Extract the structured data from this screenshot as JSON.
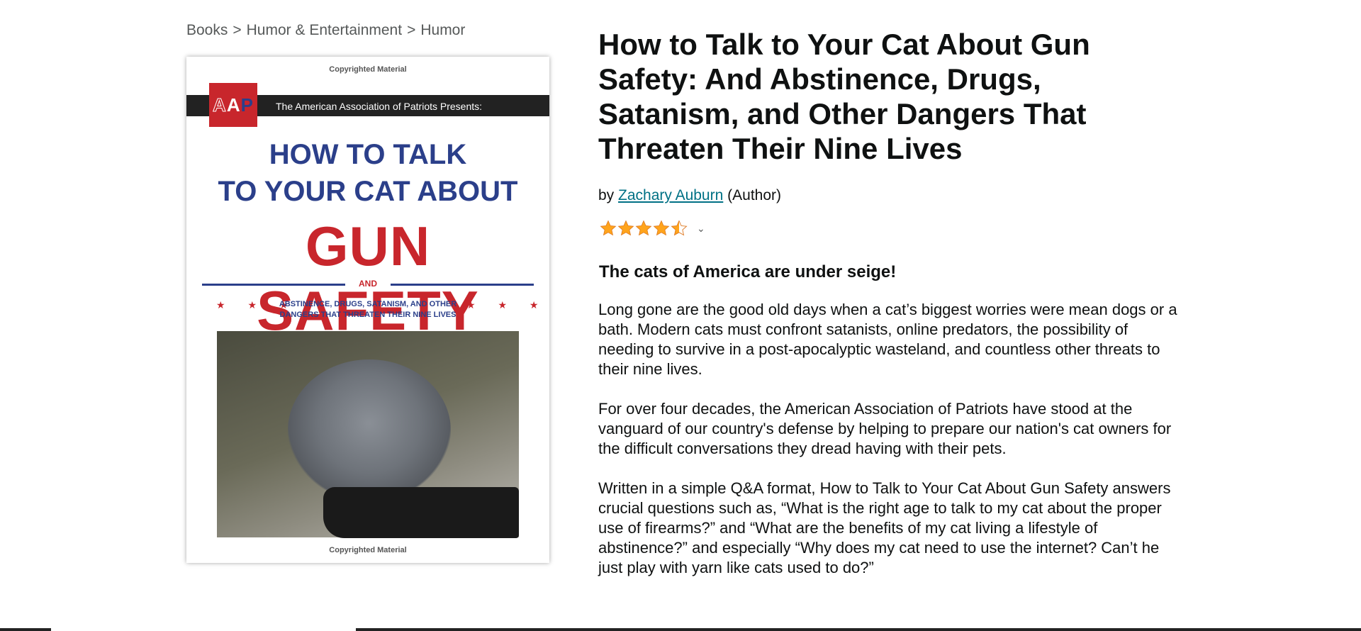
{
  "breadcrumb": {
    "items": [
      "Books",
      "Humor & Entertainment",
      "Humor"
    ],
    "separator": ">"
  },
  "cover": {
    "copyright_top": "Copyrighted Material",
    "copyright_bottom": "Copyrighted Material",
    "logo_text": [
      "A",
      "A",
      "P"
    ],
    "band_text": "The American Association of Patriots Presents:",
    "title_line1": "HOW TO TALK",
    "title_line2": "TO YOUR CAT ABOUT",
    "title_big": "GUN SAFETY",
    "and_word": "AND",
    "subtitle_line1": "ABSTINENCE, DRUGS, SATANISM, AND OTHER",
    "subtitle_line2": "DANGERS THAT THREATEN THEIR NINE LIVES",
    "stars_left": "★ ★ ★",
    "stars_right": "★ ★ ★"
  },
  "product": {
    "title": "How to Talk to Your Cat About Gun Safety: And Abstinence, Drugs, Satanism, and Other Dangers That Threaten Their Nine Lives",
    "by_prefix": "by",
    "author": "Zachary Auburn",
    "author_role": "(Author)",
    "rating_stars": 4.5,
    "rating_icon": "chevron-down-icon"
  },
  "description": {
    "headline": "The cats of America are under seige!",
    "paragraphs": [
      "Long gone are the good old days when a cat’s biggest worries were mean dogs or a bath. Modern cats must confront satanists, online predators, the possibility of needing to survive in a post-apocalyptic wasteland, and countless other threats to their nine lives.",
      "For over four decades, the American Association of Patriots have stood at the vanguard of our country's defense by helping to prepare our nation's cat owners for the difficult conversations they dread having with their pets.",
      "Written in a simple Q&A format, How to Talk to Your Cat About Gun Safety answers crucial questions such as, “What is the right age to talk to my cat about the proper use of firearms?” and “What are the benefits of my cat living a lifestyle of abstinence?” and especially “Why does my cat need to use the internet? Can’t he just play with yarn like cats used to do?”"
    ]
  },
  "colors": {
    "link": "#007185",
    "star": "#ffa41c",
    "cover_red": "#c8262c",
    "cover_blue": "#2b3f8a"
  }
}
